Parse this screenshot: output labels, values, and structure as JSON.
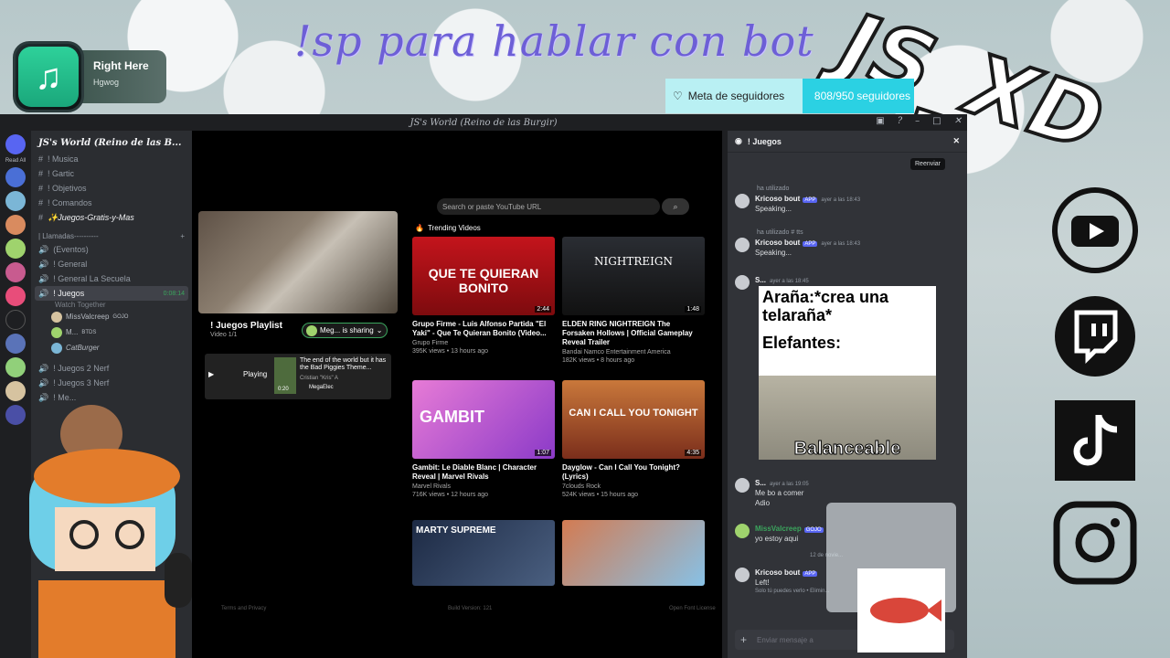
{
  "overlay": {
    "command_banner": "!sp para hablar con bot",
    "brand": "JS_XD",
    "music": {
      "title": "Right Here",
      "artist": "Hgwog"
    },
    "goal": {
      "label": "Meta de seguidores",
      "count": "808/950",
      "unit": "seguidores"
    },
    "socials": [
      "youtube-icon",
      "twitch-icon",
      "tiktok-icon",
      "instagram-icon"
    ]
  },
  "window": {
    "title": "JS's World (Reino de las Burgir)"
  },
  "sidebar": {
    "server_name": "JS's World (Reino de las B...",
    "read_all": "Read All",
    "channels": [
      {
        "icon": "#",
        "label": "! Musica"
      },
      {
        "icon": "#",
        "label": "! Gartic"
      },
      {
        "icon": "#",
        "label": "! Objetivos"
      },
      {
        "icon": "#",
        "label": "! Comandos"
      },
      {
        "icon": "#",
        "label": "✨Juegos-Gratis-y-Mas"
      }
    ],
    "category": "| Llamadas----------",
    "voice": [
      {
        "label": "(Eventos)"
      },
      {
        "label": "! General"
      },
      {
        "label": "! General La Secuela"
      }
    ],
    "active_voice": {
      "label": "! Juegos",
      "timer": "0:08:14",
      "sub": "Watch Together"
    },
    "voice_users": [
      "MissValcreep",
      "M...",
      "CatBurger"
    ],
    "user_tags": [
      "GOJO",
      "BTDS",
      ""
    ],
    "more_voice": [
      "! Juegos 2 Nerf",
      "! Juegos 3 Nerf",
      "! Me..."
    ]
  },
  "activity": {
    "playlist_title": "! Juegos Playlist",
    "playlist_sub": "Video 1/1",
    "share_label": "Meg... is sharing",
    "now_playing": {
      "state": "Playing",
      "title": "The end of the world but it has the Bad Piggies Theme...",
      "channel": "Cristian \"Kris\" A",
      "time": "0:20",
      "user": "MegaElec"
    },
    "search_placeholder": "Search or paste YouTube URL",
    "trending_label": "Trending Videos",
    "videos": [
      {
        "title": "Grupo Firme - Luis Alfonso Partida \"El Yaki\" - Que Te Quieran Bonito (Video...",
        "channel": "Grupo Firme",
        "meta": "395K views • 13 hours ago",
        "duration": "2:44",
        "thumb_text": "QUE TE QUIERAN BONITO"
      },
      {
        "title": "ELDEN RING NIGHTREIGN The Forsaken Hollows | Official Gameplay Reveal Trailer",
        "channel": "Bandai Namco Entertainment America",
        "meta": "182K views • 8 hours ago",
        "duration": "1:48",
        "thumb_text": "NIGHTREIGN"
      },
      {
        "title": "Gambit: Le Diable Blanc | Character Reveal | Marvel Rivals",
        "channel": "Marvel Rivals",
        "meta": "716K views • 12 hours ago",
        "duration": "1:07",
        "thumb_text": "GAMBIT"
      },
      {
        "title": "Dayglow - Can I Call You Tonight? (Lyrics)",
        "channel": "7clouds Rock",
        "meta": "524K views • 15 hours ago",
        "duration": "4:35",
        "thumb_text": "CAN I CALL YOU TONIGHT"
      },
      {
        "title": "",
        "channel": "",
        "meta": "",
        "duration": "",
        "thumb_text": "MARTY SUPREME"
      },
      {
        "title": "",
        "channel": "",
        "meta": "",
        "duration": "",
        "thumb_text": ""
      }
    ],
    "footer_left": "Terms and Privacy",
    "footer_mid": "Build Version: 121",
    "footer_right": "Open Font License"
  },
  "chat": {
    "channel": "! Juegos",
    "tooltip": "Reenviar",
    "messages": [
      {
        "sys": "ha utilizado",
        "name": "Kricoso bout",
        "app": "APP",
        "time": "ayer a las 18:43",
        "text": "Speaking..."
      },
      {
        "sys": "ha utilizado  # tts",
        "name": "Kricoso bout",
        "app": "APP",
        "time": "ayer a las 18:43",
        "text": "Speaking..."
      },
      {
        "sys": "",
        "name": "S...",
        "app": "",
        "time": "ayer a las 18:45",
        "text": ""
      },
      {
        "sys": "",
        "name": "S...",
        "app": "",
        "time": "ayer a las 19:05",
        "text": "Me bo a comer"
      },
      {
        "sys": "",
        "name": "",
        "app": "",
        "time": "",
        "text": "Adio"
      },
      {
        "sys": "",
        "name": "MissValcreep",
        "app": "GOJO",
        "time": "",
        "text": "yo estoy aqui"
      },
      {
        "sys": "",
        "name": "Kricoso bout",
        "app": "APP",
        "time": "",
        "text": "Left!"
      }
    ],
    "date_divider": "12 de novie...",
    "ephemeral": "Solo tú puedes verlo • Elimin...",
    "meme": {
      "top": "Araña:*crea una telaraña*",
      "mid": "Elefantes:",
      "bottom": "Balanceable"
    },
    "input_placeholder": "Enviar mensaje a"
  }
}
